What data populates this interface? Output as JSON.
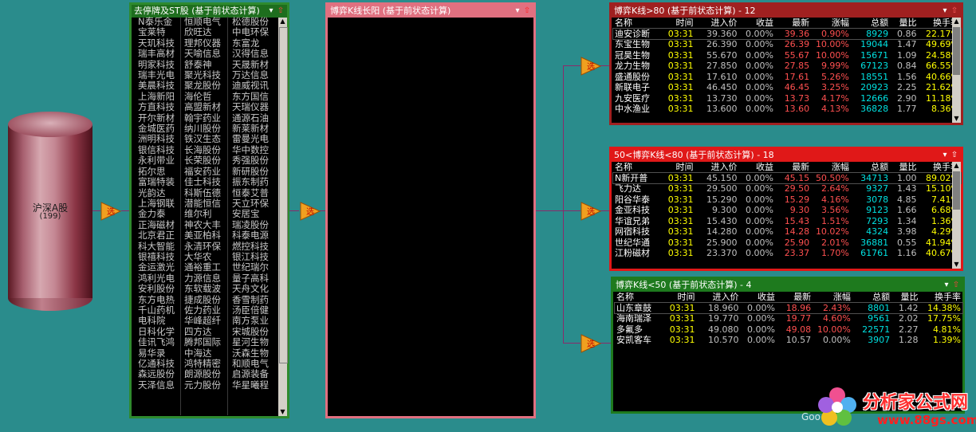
{
  "source": {
    "name": "沪深A股",
    "count": "(199)"
  },
  "filter_icon_label": "选",
  "list_panel": {
    "title": "去停牌及ST股 (基于前状态计算)",
    "col1": [
      "N泰乐金",
      "宝莱特",
      "天玑科技",
      "瑞丰高材",
      "明家科技",
      "瑞丰光电",
      "美晨科技",
      "上海新阳",
      "方直科技",
      "开尔新材",
      "金城医药",
      "洲明科技",
      "银信科技",
      "永利带业",
      "拓尔思",
      "富瑞特装",
      "光韵达",
      "上海钢联",
      "金力泰",
      "正海磁材",
      "北京君正",
      "科大智能",
      "银禧科技",
      "金运激光",
      "鸿利光电",
      "安利股份",
      "东方电热",
      "千山药机",
      "电科院",
      "日科化学",
      "佳讯飞鸿",
      "易华录",
      "亿通科技",
      "森远股份",
      "天泽信息"
    ],
    "col2": [
      "恒顺电气",
      "欣旺达",
      "理邦仪器",
      "天喻信息",
      "舒泰神",
      "聚光科技",
      "聚龙股份",
      "海伦哲",
      "高盟新材",
      "翰宇药业",
      "纳川股份",
      "铁汉生态",
      "长海股份",
      "长荣股份",
      "福安药业",
      "佳士科技",
      "科斯伍德",
      "潜能恒信",
      "维尔利",
      "神农大丰",
      "美亚柏科",
      "永清环保",
      "大华农",
      "通裕重工",
      "力源信息",
      "东软载波",
      "捷成股份",
      "佐力药业",
      "华峰超纤",
      "四方达",
      "腾邦国际",
      "中海达",
      "鸿特精密",
      "朗源股份",
      "元力股份"
    ],
    "col3": [
      "松德股份",
      "中电环保",
      "东富龙",
      "汉得信息",
      "天晟新材",
      "万达信息",
      "迪威视讯",
      "东方国信",
      "天瑞仪器",
      "通源石油",
      "新莱新材",
      "雷曼光电",
      "华中数控",
      "秀强股份",
      "新研股份",
      "振东制药",
      "恒泰艾普",
      "天立环保",
      "安居宝",
      "瑞凌股份",
      "科泰电源",
      "燃控科技",
      "银江科技",
      "世纪瑞尔",
      "量子高科",
      "天舟文化",
      "香雪制药",
      "汤臣倍健",
      "南方泵业",
      "宋城股份",
      "星河生物",
      "沃森生物",
      "和顺电气",
      "启源装备",
      "华星曦程"
    ]
  },
  "mid_panel": {
    "title": "博弈K线长阳 (基于前状态计算)"
  },
  "panels": [
    {
      "title": "博弈K线>80 (基于前状态计算) - 12",
      "headers": [
        "名称",
        "时间",
        "进入价",
        "收益",
        "最新",
        "涨幅",
        "总额",
        "量比",
        "换手率"
      ],
      "rows": [
        [
          "迪安诊断",
          "03:31",
          "39.360",
          "0.00%",
          "39.36",
          "0.90%",
          "8929",
          "0.86",
          "22.17%"
        ],
        [
          "东宝生物",
          "03:31",
          "26.390",
          "0.00%",
          "26.39",
          "10.00%",
          "19044",
          "1.47",
          "49.69%"
        ],
        [
          "冠昊生物",
          "03:31",
          "55.670",
          "0.00%",
          "55.67",
          "10.00%",
          "15671",
          "1.09",
          "24.58%"
        ],
        [
          "龙力生物",
          "03:31",
          "27.850",
          "0.00%",
          "27.85",
          "9.99%",
          "67123",
          "0.84",
          "66.55%"
        ],
        [
          "盛通股份",
          "03:31",
          "17.610",
          "0.00%",
          "17.61",
          "5.26%",
          "18551",
          "1.56",
          "40.66%"
        ],
        [
          "新联电子",
          "03:31",
          "46.450",
          "0.00%",
          "46.45",
          "3.25%",
          "20923",
          "2.25",
          "21.62%"
        ],
        [
          "九安医疗",
          "03:31",
          "13.730",
          "0.00%",
          "13.73",
          "4.17%",
          "12666",
          "2.90",
          "11.18%"
        ],
        [
          "中水渔业",
          "03:31",
          "13.600",
          "0.00%",
          "13.60",
          "4.13%",
          "36828",
          "1.77",
          "8.36%"
        ]
      ]
    },
    {
      "title": "50<博弈K线<80 (基于前状态计算) - 18",
      "headers": [
        "名称",
        "时间",
        "进入价",
        "收益",
        "最新",
        "涨幅",
        "总额",
        "量比",
        "换手率"
      ],
      "rows": [
        [
          "N新开普",
          "03:31",
          "45.150",
          "0.00%",
          "45.15",
          "50.50%",
          "34713",
          "1.00",
          "89.02%"
        ],
        [
          "飞力达",
          "03:31",
          "29.500",
          "0.00%",
          "29.50",
          "2.64%",
          "9327",
          "1.43",
          "15.10%"
        ],
        [
          "阳谷华泰",
          "03:31",
          "15.290",
          "0.00%",
          "15.29",
          "4.16%",
          "3078",
          "4.85",
          "7.41%"
        ],
        [
          "金亚科技",
          "03:31",
          "9.300",
          "0.00%",
          "9.30",
          "3.56%",
          "9123",
          "1.66",
          "6.68%"
        ],
        [
          "华谊兄弟",
          "03:31",
          "15.430",
          "0.00%",
          "15.43",
          "1.51%",
          "7293",
          "1.34",
          "1.36%"
        ],
        [
          "网宿科技",
          "03:31",
          "14.280",
          "0.00%",
          "14.28",
          "10.02%",
          "4324",
          "3.98",
          "4.29%"
        ],
        [
          "世纪华通",
          "03:31",
          "25.900",
          "0.00%",
          "25.90",
          "2.01%",
          "36881",
          "0.55",
          "41.94%"
        ],
        [
          "江粉磁材",
          "03:31",
          "23.370",
          "0.00%",
          "23.37",
          "1.70%",
          "61761",
          "1.16",
          "40.67%"
        ]
      ]
    },
    {
      "title": "博弈K线<50 (基于前状态计算) - 4",
      "headers": [
        "名称",
        "时间",
        "进入价",
        "收益",
        "最新",
        "涨幅",
        "总额",
        "量比",
        "换手率"
      ],
      "rows": [
        [
          "山东章鼓",
          "03:31",
          "18.960",
          "0.00%",
          "18.96",
          "2.43%",
          "8801",
          "1.42",
          "14.38%"
        ],
        [
          "海南瑞泽",
          "03:31",
          "19.770",
          "0.00%",
          "19.77",
          "4.60%",
          "9561",
          "2.02",
          "17.75%"
        ],
        [
          "多氟多",
          "03:31",
          "49.080",
          "0.00%",
          "49.08",
          "10.00%",
          "22571",
          "2.27",
          "4.81%"
        ],
        [
          "安凯客车",
          "03:31",
          "10.570",
          "0.00%",
          "10.57",
          "0.00%",
          "3907",
          "1.28",
          "1.39%"
        ]
      ]
    }
  ],
  "watermark": {
    "text": "分析家公式网",
    "url": "www.88gs.com",
    "partial": "Goo"
  },
  "colors": {
    "bg": "#2a8c8c",
    "list_border": "#2e8a2e",
    "mid_border": "#e07080",
    "panel1_border": "#a02020",
    "panel2_border": "#e01818",
    "panel3_border": "#1e7a1e"
  }
}
